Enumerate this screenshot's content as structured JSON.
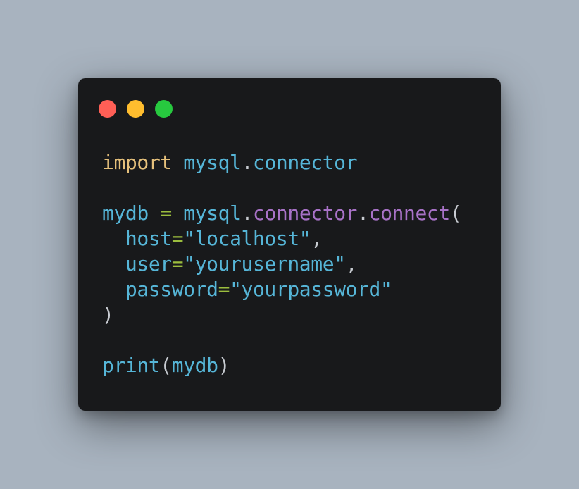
{
  "window": {
    "controls": {
      "close_color": "#ff5f56",
      "minimize_color": "#ffbd2e",
      "maximize_color": "#27c93f"
    }
  },
  "code": {
    "language": "python",
    "lines": [
      [
        {
          "t": "import",
          "c": "kw"
        },
        {
          "t": " ",
          "c": "punc"
        },
        {
          "t": "mysql",
          "c": "id"
        },
        {
          "t": ".",
          "c": "punc"
        },
        {
          "t": "connector",
          "c": "id"
        }
      ],
      [],
      [
        {
          "t": "mydb",
          "c": "id"
        },
        {
          "t": " ",
          "c": "punc"
        },
        {
          "t": "=",
          "c": "op"
        },
        {
          "t": " ",
          "c": "punc"
        },
        {
          "t": "mysql",
          "c": "id"
        },
        {
          "t": ".",
          "c": "punc"
        },
        {
          "t": "connector",
          "c": "attr"
        },
        {
          "t": ".",
          "c": "punc"
        },
        {
          "t": "connect",
          "c": "attr"
        },
        {
          "t": "(",
          "c": "punc"
        }
      ],
      [
        {
          "t": "  ",
          "c": "punc"
        },
        {
          "t": "host",
          "c": "id"
        },
        {
          "t": "=",
          "c": "op"
        },
        {
          "t": "\"localhost\"",
          "c": "str"
        },
        {
          "t": ",",
          "c": "punc"
        }
      ],
      [
        {
          "t": "  ",
          "c": "punc"
        },
        {
          "t": "user",
          "c": "id"
        },
        {
          "t": "=",
          "c": "op"
        },
        {
          "t": "\"yourusername\"",
          "c": "str"
        },
        {
          "t": ",",
          "c": "punc"
        }
      ],
      [
        {
          "t": "  ",
          "c": "punc"
        },
        {
          "t": "password",
          "c": "id"
        },
        {
          "t": "=",
          "c": "op"
        },
        {
          "t": "\"yourpassword\"",
          "c": "str"
        }
      ],
      [
        {
          "t": ")",
          "c": "punc"
        }
      ],
      [],
      [
        {
          "t": "print",
          "c": "fn"
        },
        {
          "t": "(",
          "c": "punc"
        },
        {
          "t": "mydb",
          "c": "id"
        },
        {
          "t": ")",
          "c": "punc"
        }
      ]
    ]
  }
}
